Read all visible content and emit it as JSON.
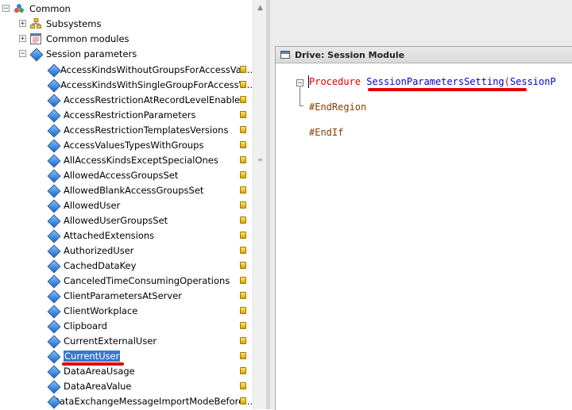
{
  "tree": {
    "root": {
      "label": "Common"
    },
    "groups": [
      {
        "label": "Subsystems",
        "icon": "subsystems-icon"
      },
      {
        "label": "Common modules",
        "icon": "common-modules-icon"
      },
      {
        "label": "Session parameters",
        "icon": "session-parameters-icon"
      }
    ],
    "items": [
      {
        "label": "AccessKindsWithoutGroupsForAccessVal..."
      },
      {
        "label": "AccessKindsWithSingleGroupForAccessV..."
      },
      {
        "label": "AccessRestrictionAtRecordLevelEnabled"
      },
      {
        "label": "AccessRestrictionParameters"
      },
      {
        "label": "AccessRestrictionTemplatesVersions"
      },
      {
        "label": "AccessValuesTypesWithGroups"
      },
      {
        "label": "AllAccessKindsExceptSpecialOnes"
      },
      {
        "label": "AllowedAccessGroupsSet"
      },
      {
        "label": "AllowedBlankAccessGroupsSet"
      },
      {
        "label": "AllowedUser"
      },
      {
        "label": "AllowedUserGroupsSet"
      },
      {
        "label": "AttachedExtensions"
      },
      {
        "label": "AuthorizedUser"
      },
      {
        "label": "CachedDataKey"
      },
      {
        "label": "CanceledTimeConsumingOperations"
      },
      {
        "label": "ClientParametersAtServer"
      },
      {
        "label": "ClientWorkplace"
      },
      {
        "label": "Clipboard"
      },
      {
        "label": "CurrentExternalUser"
      },
      {
        "label": "CurrentUser",
        "selected": true
      },
      {
        "label": "DataAreaUsage"
      },
      {
        "label": "DataAreaValue"
      },
      {
        "label": "DataExchangeMessageImportModeBefore..."
      }
    ]
  },
  "editor": {
    "title": "Drive: Session Module",
    "fold_symbol": "−",
    "line1": {
      "keyword": "Procedure",
      "name": "SessionParametersSetting",
      "paren": "(",
      "param": "SessionP"
    },
    "line2": "#EndRegion",
    "line3": "#EndIf"
  },
  "colors": {
    "selection": "#3a77c8",
    "keyword": "#e00000",
    "identifier": "#0000cc",
    "directive": "#8a3e00",
    "highlight_mark": "#e00000"
  }
}
